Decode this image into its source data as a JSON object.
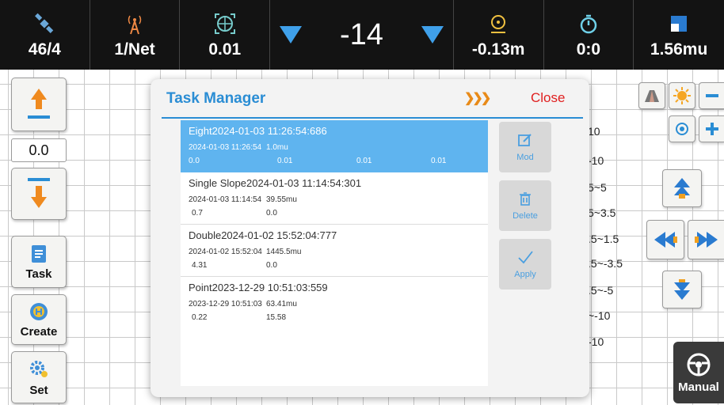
{
  "topbar": {
    "satellites": "46/4",
    "network": "1/Net",
    "precision": "0.01",
    "offset": "-14",
    "deviation": "-0.13m",
    "timer": "0:0",
    "area": "1.56mu"
  },
  "left_panel": {
    "value": "0.0",
    "task_label": "Task",
    "create_label": "Create",
    "set_label": "Set"
  },
  "right_panel": {
    "scale_labels": [
      "10",
      "-10",
      "5~5",
      "5~3.5",
      ".5~1.5",
      ".5~-3.5",
      ".5~-5",
      "~-10",
      "-10"
    ],
    "manual_label": "Manual"
  },
  "dialog": {
    "title": "Task Manager",
    "close_label": "Close",
    "mod_label": "Mod",
    "delete_label": "Delete",
    "apply_label": "Apply",
    "tasks": [
      {
        "name": "Eight2024-01-03 11:26:54:686",
        "date": "2024-01-03 11:26:54",
        "area": "1.0mu",
        "v1": "0.0",
        "v2": "0.01",
        "v3": "0.01",
        "v4": "0.01"
      },
      {
        "name": "Single Slope2024-01-03 11:14:54:301",
        "date": "2024-01-03 11:14:54",
        "area": "39.55mu",
        "v1": "0.7",
        "v2": "0.0"
      },
      {
        "name": "Double2024-01-02 15:52:04:777",
        "date": "2024-01-02 15:52:04",
        "area": "1445.5mu",
        "v1": "4.31",
        "v2": "0.0"
      },
      {
        "name": "Point2023-12-29 10:51:03:559",
        "date": "2023-12-29 10:51:03",
        "area": "63.41mu",
        "v1": "0.22",
        "v2": "15.58"
      }
    ]
  },
  "colors": {
    "accent_blue": "#2a8dd4",
    "selected_row": "#5fb4ef",
    "close_red": "#e02020",
    "chevron_orange": "#e88a18"
  }
}
